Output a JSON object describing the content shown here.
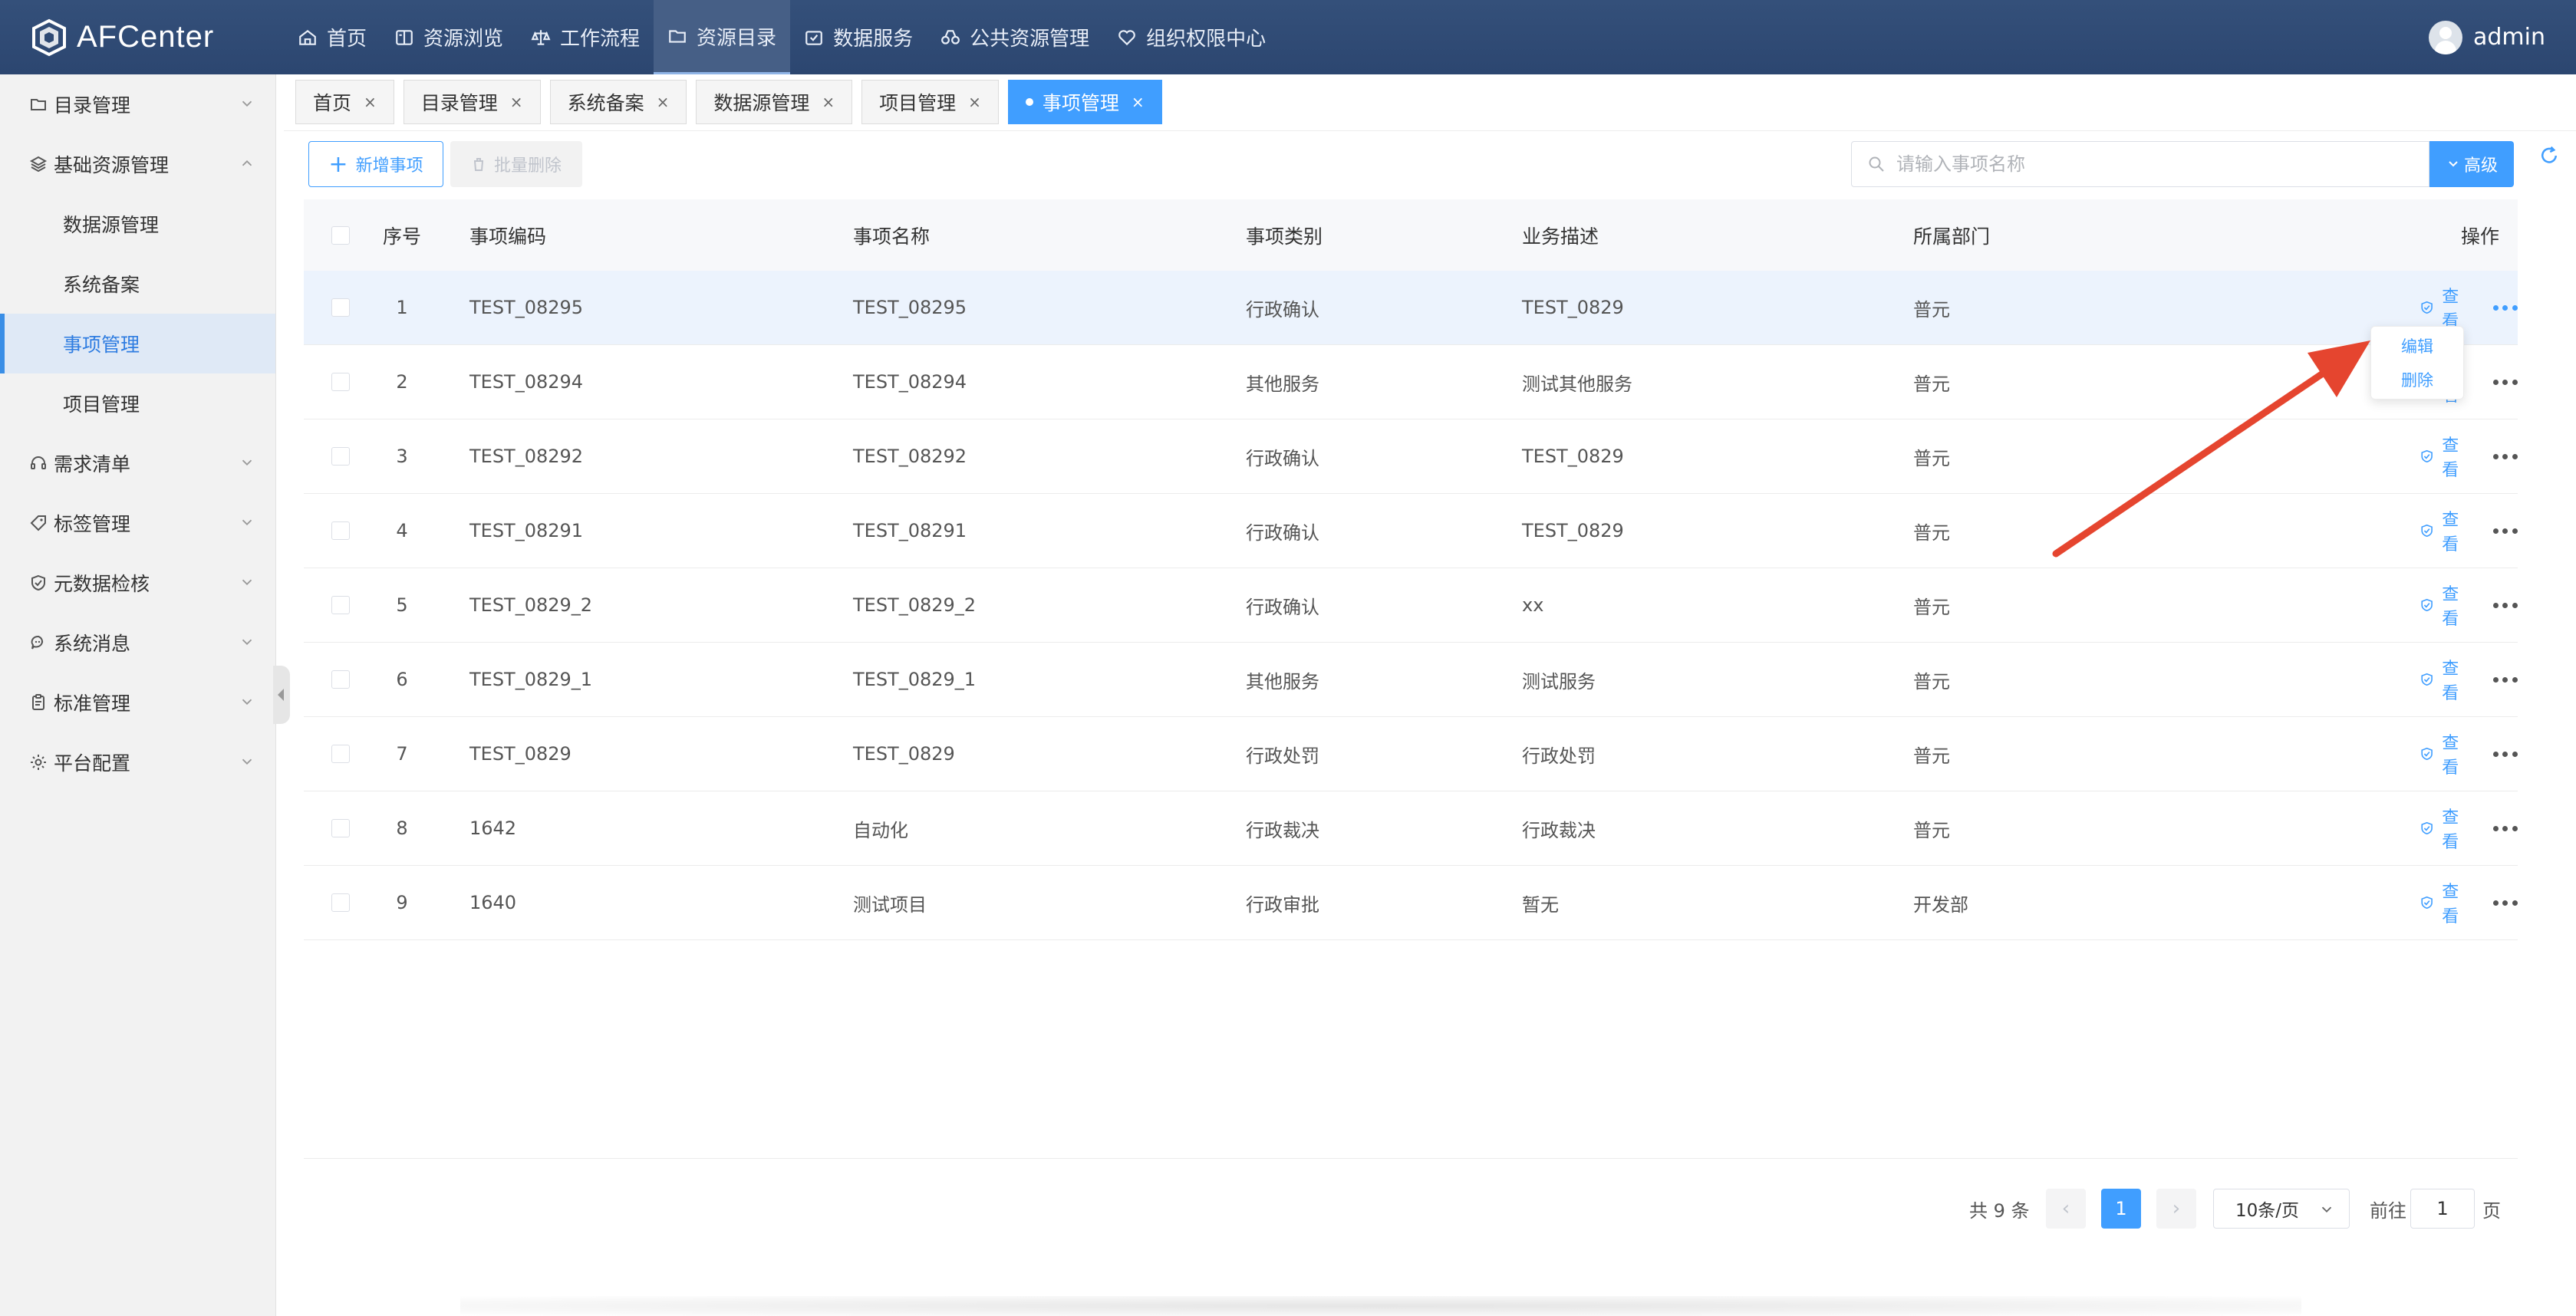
{
  "brand": {
    "name": "AFCenter"
  },
  "topnav": [
    {
      "label": "首页",
      "icon": "home-icon"
    },
    {
      "label": "资源浏览",
      "icon": "book-icon"
    },
    {
      "label": "工作流程",
      "icon": "scale-icon"
    },
    {
      "label": "资源目录",
      "icon": "folder-icon",
      "active": true
    },
    {
      "label": "数据服务",
      "icon": "box-icon"
    },
    {
      "label": "公共资源管理",
      "icon": "binoculars-icon"
    },
    {
      "label": "组织权限中心",
      "icon": "heart-icon"
    }
  ],
  "user": {
    "name": "admin"
  },
  "sidebar": {
    "groups": [
      {
        "label": "目录管理",
        "icon": "folder-icon",
        "expanded": false
      },
      {
        "label": "基础资源管理",
        "icon": "layers-icon",
        "expanded": true
      },
      {
        "label": "需求清单",
        "icon": "headset-icon",
        "expanded": false
      },
      {
        "label": "标签管理",
        "icon": "tag-icon",
        "expanded": false
      },
      {
        "label": "元数据检核",
        "icon": "shield-check-icon",
        "expanded": false
      },
      {
        "label": "系统消息",
        "icon": "chat-icon",
        "expanded": false
      },
      {
        "label": "标准管理",
        "icon": "clipboard-icon",
        "expanded": false
      },
      {
        "label": "平台配置",
        "icon": "gear-icon",
        "expanded": false
      }
    ],
    "subitems": [
      {
        "label": "数据源管理"
      },
      {
        "label": "系统备案"
      },
      {
        "label": "事项管理",
        "active": true
      },
      {
        "label": "项目管理"
      }
    ]
  },
  "tabs": [
    {
      "label": "首页",
      "close": "×"
    },
    {
      "label": "目录管理",
      "close": "×"
    },
    {
      "label": "系统备案",
      "close": "×"
    },
    {
      "label": "数据源管理",
      "close": "×"
    },
    {
      "label": "项目管理",
      "close": "×"
    },
    {
      "label": "事项管理",
      "close": "×",
      "active": true
    }
  ],
  "toolbar": {
    "add_label": "新增事项",
    "batch_delete_label": "批量删除",
    "search_placeholder": "请输入事项名称",
    "advanced_label": "高级"
  },
  "table": {
    "headers": {
      "no": "序号",
      "code": "事项编码",
      "name": "事项名称",
      "type": "事项类别",
      "desc": "业务描述",
      "dept": "所属部门",
      "op": "操作"
    },
    "view_label": "查看",
    "rows": [
      {
        "no": "1",
        "code": "TEST_08295",
        "name": "TEST_08295",
        "type": "行政确认",
        "desc": "TEST_0829",
        "dept": "普元"
      },
      {
        "no": "2",
        "code": "TEST_08294",
        "name": "TEST_08294",
        "type": "其他服务",
        "desc": "测试其他服务",
        "dept": "普元"
      },
      {
        "no": "3",
        "code": "TEST_08292",
        "name": "TEST_08292",
        "type": "行政确认",
        "desc": "TEST_0829",
        "dept": "普元"
      },
      {
        "no": "4",
        "code": "TEST_08291",
        "name": "TEST_08291",
        "type": "行政确认",
        "desc": "TEST_0829",
        "dept": "普元"
      },
      {
        "no": "5",
        "code": "TEST_0829_2",
        "name": "TEST_0829_2",
        "type": "行政确认",
        "desc": "xx",
        "dept": "普元"
      },
      {
        "no": "6",
        "code": "TEST_0829_1",
        "name": "TEST_0829_1",
        "type": "其他服务",
        "desc": "测试服务",
        "dept": "普元"
      },
      {
        "no": "7",
        "code": "TEST_0829",
        "name": "TEST_0829",
        "type": "行政处罚",
        "desc": "行政处罚",
        "dept": "普元"
      },
      {
        "no": "8",
        "code": "1642",
        "name": "自动化",
        "type": "行政裁决",
        "desc": "行政裁决",
        "dept": "普元"
      },
      {
        "no": "9",
        "code": "1640",
        "name": "测试项目",
        "type": "行政审批",
        "desc": "暂无",
        "dept": "开发部"
      }
    ]
  },
  "dropdown": {
    "edit_label": "编辑",
    "delete_label": "删除"
  },
  "pagination": {
    "total_text": "共 9 条",
    "current_page": "1",
    "page_size": "10条/页",
    "goto_label": "前往",
    "goto_value": "1",
    "unit_label": "页"
  },
  "colors": {
    "topbar": "#2f4a74",
    "primary": "#409eff",
    "annotation_arrow": "#e5452f"
  }
}
